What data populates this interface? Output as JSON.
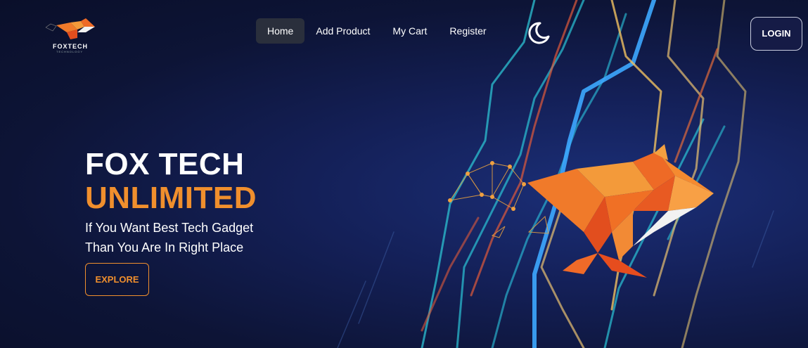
{
  "brand": {
    "name": "FOXTECH",
    "tagline": "TECHNOLOGY"
  },
  "nav": {
    "links": [
      {
        "label": "Home",
        "active": true
      },
      {
        "label": "Add Product",
        "active": false
      },
      {
        "label": "My Cart",
        "active": false
      },
      {
        "label": "Register",
        "active": false
      }
    ],
    "theme_icon": "moon-icon",
    "login_label": "LOGIN"
  },
  "hero": {
    "title_line1": "FOX TECH",
    "title_line2": "UNLIMITED",
    "subtitle_line1": "If You Want Best Tech Gadget",
    "subtitle_line2": "Than You Are In Right Place",
    "cta_label": "EXPLORE"
  },
  "colors": {
    "accent": "#f08f2d",
    "background": "#0d1436",
    "nav_active": "#2a2f3c"
  }
}
